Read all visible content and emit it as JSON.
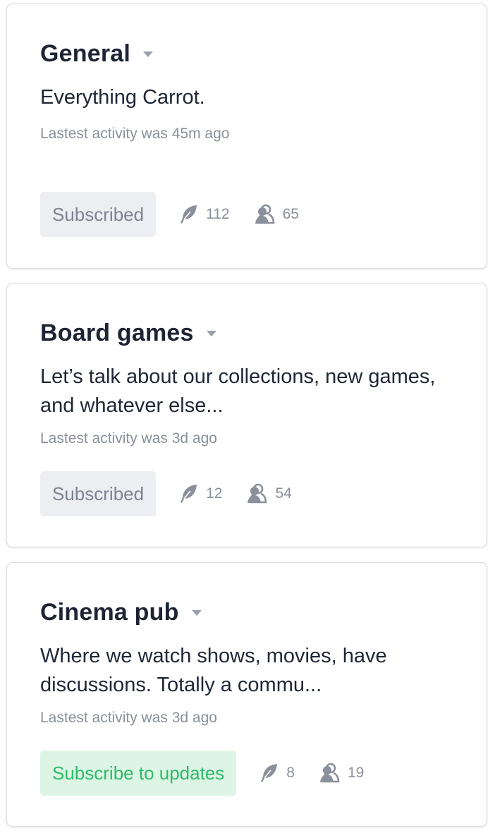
{
  "cards": [
    {
      "title": "General",
      "description": "Everything Carrot.",
      "activity": "Lastest activity was 45m ago",
      "button_label": "Subscribed",
      "posts": "112",
      "members": "65"
    },
    {
      "title": "Board games",
      "description": "Let’s talk about our collections, new games, and whatever else...",
      "activity": "Lastest activity was 3d ago",
      "button_label": "Subscribed",
      "posts": "12",
      "members": "54"
    },
    {
      "title": "Cinema pub",
      "description": "Where we watch shows, movies, have discussions. Totally a commu...",
      "activity": "Lastest activity was 3d ago",
      "button_label": "Subscribe to updates",
      "posts": "8",
      "members": "19"
    }
  ],
  "icons": {
    "posts": "feather-icon",
    "members": "members-icon",
    "caret": "caret-down-icon"
  },
  "colors": {
    "subscribed_bg": "#eceef1",
    "subscribed_text": "#7d8390",
    "subscribe_bg": "#dcf5e4",
    "subscribe_text": "#2dbb6a"
  }
}
